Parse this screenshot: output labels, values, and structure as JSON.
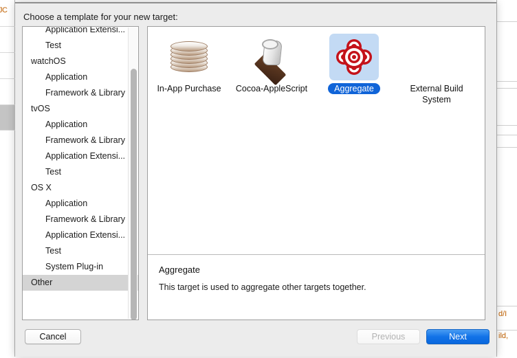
{
  "sheet": {
    "title": "Choose a template for your new target:"
  },
  "background": {
    "left_fragment": "JC",
    "right_fragments": [
      "d/I",
      "ild,"
    ]
  },
  "category_list": {
    "items": [
      {
        "label": "Application Extensi...",
        "level": "child",
        "selected": false
      },
      {
        "label": "Test",
        "level": "child",
        "selected": false
      },
      {
        "label": "watchOS",
        "level": "group",
        "selected": false
      },
      {
        "label": "Application",
        "level": "child",
        "selected": false
      },
      {
        "label": "Framework & Library",
        "level": "child",
        "selected": false
      },
      {
        "label": "tvOS",
        "level": "group",
        "selected": false
      },
      {
        "label": "Application",
        "level": "child",
        "selected": false
      },
      {
        "label": "Framework & Library",
        "level": "child",
        "selected": false
      },
      {
        "label": "Application Extensi...",
        "level": "child",
        "selected": false
      },
      {
        "label": "Test",
        "level": "child",
        "selected": false
      },
      {
        "label": "OS X",
        "level": "group",
        "selected": false
      },
      {
        "label": "Application",
        "level": "child",
        "selected": false
      },
      {
        "label": "Framework & Library",
        "level": "child",
        "selected": false
      },
      {
        "label": "Application Extensi...",
        "level": "child",
        "selected": false
      },
      {
        "label": "Test",
        "level": "child",
        "selected": false
      },
      {
        "label": "System Plug-in",
        "level": "child",
        "selected": false
      },
      {
        "label": "Other",
        "level": "group",
        "selected": true
      }
    ]
  },
  "templates": [
    {
      "label": "In-App Purchase",
      "icon": "coin-stack-icon",
      "selected": false
    },
    {
      "label": "Cocoa-AppleScript",
      "icon": "applescript-scroll-icon",
      "selected": false
    },
    {
      "label": "Aggregate",
      "icon": "aggregate-target-icon",
      "selected": true
    },
    {
      "label": "External Build System",
      "icon": "external-build-icon",
      "selected": false
    }
  ],
  "description": {
    "title": "Aggregate",
    "body": "This target is used to aggregate other targets together."
  },
  "buttons": {
    "cancel": "Cancel",
    "previous": "Previous",
    "next": "Next"
  },
  "colors": {
    "selection_blue": "#1064d8",
    "selection_tint": "#c3daf4",
    "next_button_blue": "#1273e8",
    "inactive_row_gray": "#d4d4d4",
    "aggregate_red": "#c4121a"
  }
}
